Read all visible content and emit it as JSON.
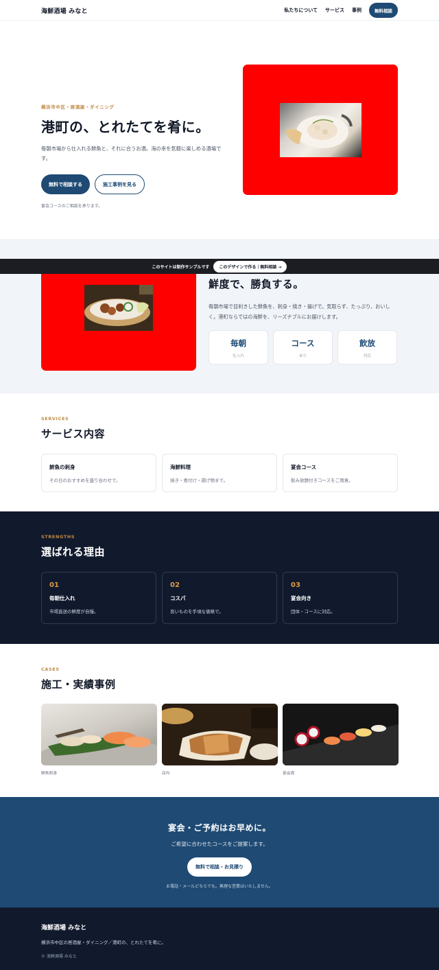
{
  "header": {
    "brand": "海鮮酒場 みなと",
    "nav": [
      "私たちについて",
      "サービス",
      "事例"
    ],
    "cta": "無料相談"
  },
  "hero": {
    "eyebrow": "横浜市中区・居酒屋・ダイニング",
    "title": "港町の、とれたてを肴に。",
    "desc": "毎朝市場から仕入れる鮮魚と、それに合うお酒。海の幸を気軽に楽しめる酒場です。",
    "primary_btn": "無料で相談する",
    "secondary_btn": "施工事例を見る",
    "note": "宴会コースのご相談を承ります。"
  },
  "banner": {
    "text": "このサイトは制作サンプルです",
    "button": "このデザインで作る｜無料相談 →"
  },
  "about": {
    "title": "鮮度で、勝負する。",
    "desc": "毎朝市場で目利きした鮮魚を、刺身・焼き・揚げで。気取らず、たっぷり、おいしく。港町ならではの海鮮を、リーズナブルにお届けします。",
    "stats": [
      {
        "value": "毎朝",
        "label": "仕入れ"
      },
      {
        "value": "コース",
        "label": "あり"
      },
      {
        "value": "飲放",
        "label": "対応"
      }
    ]
  },
  "services": {
    "kicker": "SERVICES",
    "title": "サービス内容",
    "items": [
      {
        "title": "鮮魚の刺身",
        "desc": "その日のおすすめを盛り合わせで。"
      },
      {
        "title": "海鮮料理",
        "desc": "焼き・煮付け・揚げ物まで。"
      },
      {
        "title": "宴会コース",
        "desc": "飲み放題付きコースをご用意。"
      }
    ]
  },
  "strengths": {
    "kicker": "STRENGTHS",
    "title": "選ばれる理由",
    "items": [
      {
        "num": "01",
        "title": "毎朝仕入れ",
        "desc": "市場直送の鮮度が自慢。"
      },
      {
        "num": "02",
        "title": "コスパ",
        "desc": "良いものを手頃な価格で。"
      },
      {
        "num": "03",
        "title": "宴会向き",
        "desc": "団体・コースに対応。"
      }
    ]
  },
  "cases": {
    "kicker": "CASES",
    "title": "施工・実績事例",
    "items": [
      {
        "caption": "鮮魚刺身"
      },
      {
        "caption": "店内"
      },
      {
        "caption": "宴会席"
      }
    ]
  },
  "cta": {
    "title": "宴会・ご予約はお早めに。",
    "desc": "ご希望に合わせたコースをご提案します。",
    "button": "無料で相談・お見積り",
    "note": "お電話・メールどちらでも。無理な営業はいたしません。"
  },
  "footer": {
    "brand": "海鮮酒場 みなと",
    "desc": "横浜市中区の居酒屋・ダイニング／港町の、とれたてを肴に。",
    "copy": "© 海鮮酒場 みなと"
  },
  "colors": {
    "accent": "#1e4a73",
    "kicker": "#c08a45",
    "dark": "#111a2d",
    "placeholder": "#ff0000"
  }
}
